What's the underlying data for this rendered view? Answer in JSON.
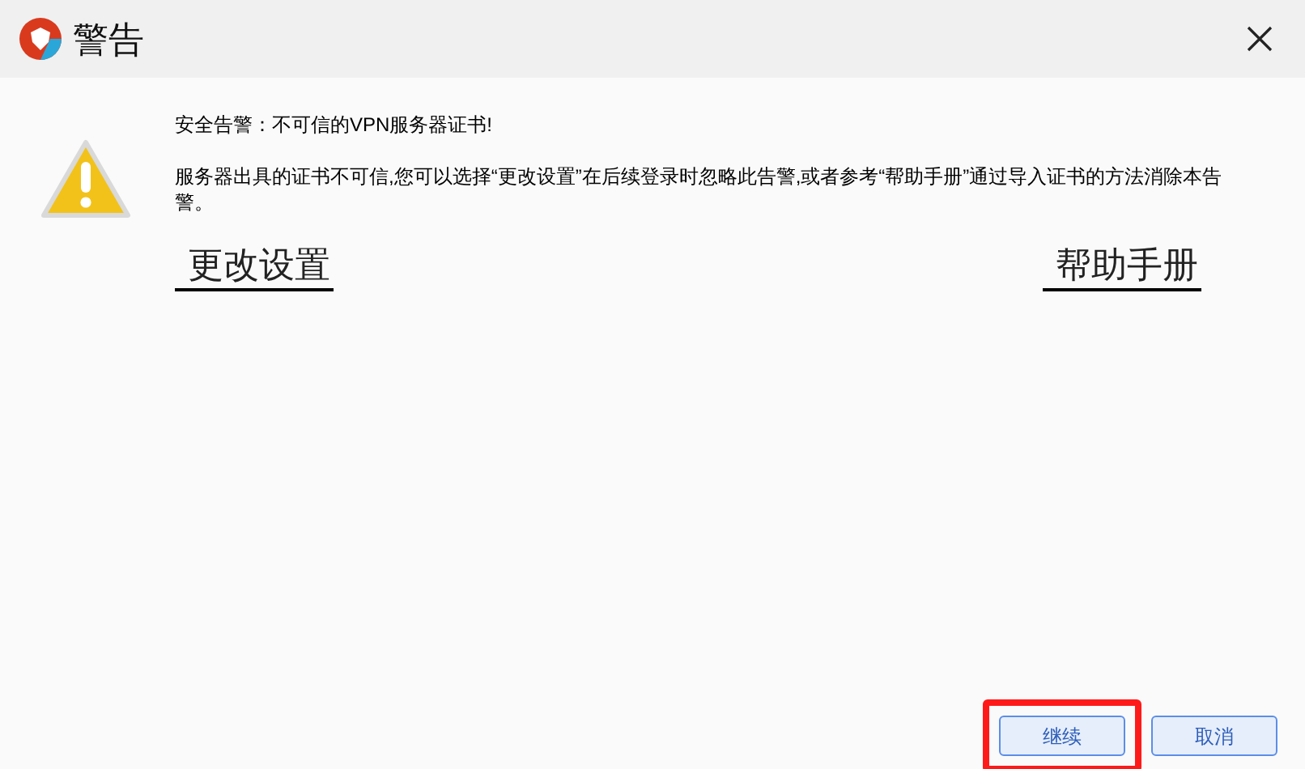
{
  "window": {
    "title": "警告"
  },
  "heading": "安全告警：不可信的VPN服务器证书!",
  "message": "服务器出具的证书不可信,您可以选择“更改设置”在后续登录时忽略此告警,或者参考“帮助手册”通过导入证书的方法消除本告警。",
  "links": [
    {
      "label": "更改设置"
    },
    {
      "label": "帮助手册"
    }
  ],
  "buttons": [
    {
      "label": "继续",
      "highlighted": true
    },
    {
      "label": "取消",
      "highlighted": false
    }
  ]
}
